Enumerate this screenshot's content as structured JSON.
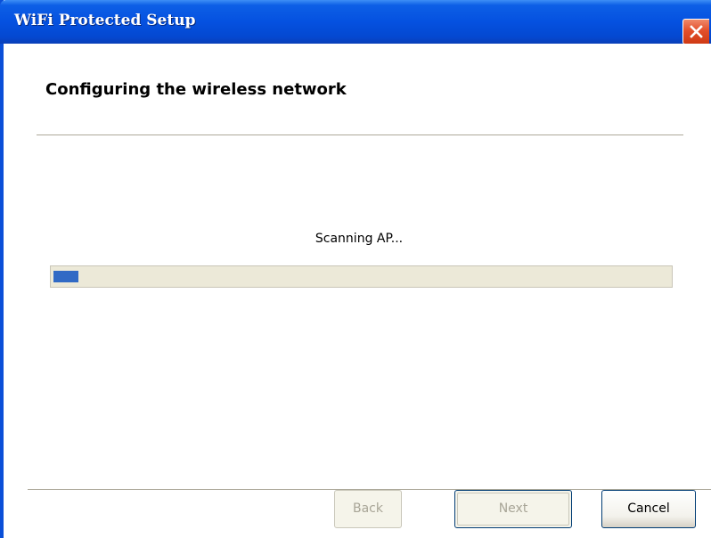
{
  "window": {
    "title": "WiFi Protected Setup",
    "close_icon": "close-icon",
    "accent_color": "#0551e0"
  },
  "header": {
    "heading": "Configuring the wireless network"
  },
  "progress": {
    "status_text": "Scanning AP...",
    "fraction": 0.04
  },
  "buttons": {
    "back": "Back",
    "next": "Next",
    "cancel": "Cancel"
  }
}
